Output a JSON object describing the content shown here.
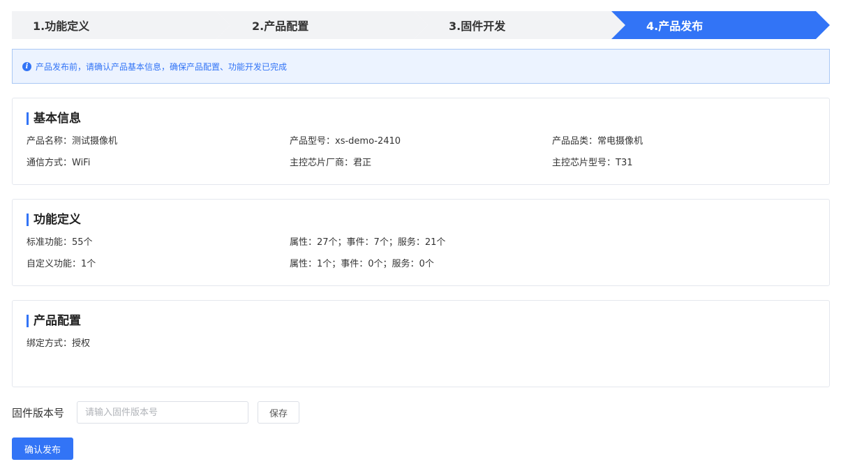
{
  "steps": [
    {
      "label": "1.功能定义",
      "active": false
    },
    {
      "label": "2.产品配置",
      "active": false
    },
    {
      "label": "3.固件开发",
      "active": false
    },
    {
      "label": "4.产品发布",
      "active": true
    }
  ],
  "alert": {
    "icon": "info-icon",
    "text": "产品发布前，请确认产品基本信息，确保产品配置、功能开发已完成"
  },
  "basic_info": {
    "title": "基本信息",
    "product_name": "产品名称：测试摄像机",
    "product_model": "产品型号：xs-demo-2410",
    "product_category": "产品品类：常电摄像机",
    "comm_method": "通信方式：WiFi",
    "chip_vendor": "主控芯片厂商：君正",
    "chip_model": "主控芯片型号：T31"
  },
  "function_def": {
    "title": "功能定义",
    "standard": "标准功能：55个",
    "standard_detail": "属性：27个；事件：7个；服务：21个",
    "custom": "自定义功能：1个",
    "custom_detail": "属性：1个；事件：0个；服务：0个"
  },
  "product_config": {
    "title": "产品配置",
    "bind_method": "绑定方式：授权"
  },
  "firmware": {
    "label": "固件版本号",
    "value": "",
    "placeholder": "请输入固件版本号",
    "save_label": "保存"
  },
  "confirm_label": "确认发布",
  "colors": {
    "primary": "#3274f6",
    "step_inactive": "#f2f3f5",
    "alert_bg": "#ecf3ff"
  }
}
